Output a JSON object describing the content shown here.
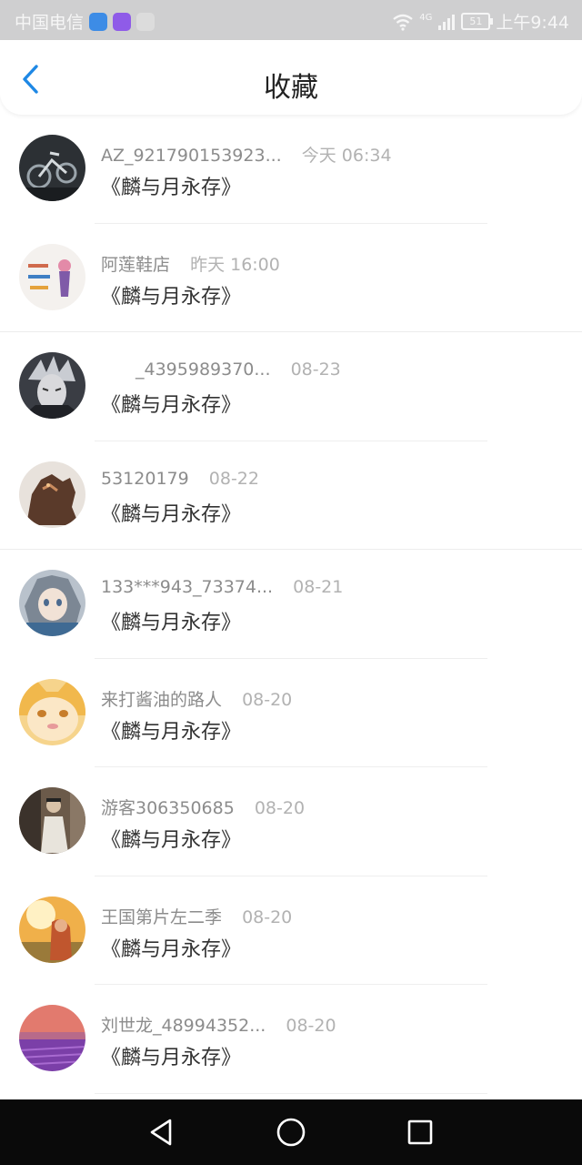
{
  "status_bar": {
    "carrier": "中国电信",
    "network": "4G",
    "battery": "51",
    "time": "上午9:44",
    "app_icons": [
      {
        "name": "shield-app-icon",
        "color": "#3d8ce6"
      },
      {
        "name": "messenger-app-icon",
        "color": "#8f5be8"
      },
      {
        "name": "image-app-icon",
        "color": "#dcdcdc"
      }
    ]
  },
  "header": {
    "title": "收藏",
    "back_icon": "chevron-left-icon",
    "accent": "#1e88e5"
  },
  "favorites": [
    {
      "user": "AZ_921790153923...",
      "date": "今天 06:34",
      "title": "《麟与月永存》",
      "avatar": "bike-avatar"
    },
    {
      "user": "阿莲鞋店",
      "date": "昨天 16:00",
      "title": "《麟与月永存》",
      "avatar": "shoe-store-avatar"
    },
    {
      "user": "_4395989370...",
      "date": "08-23",
      "title": "《麟与月永存》",
      "avatar": "anime-character-avatar"
    },
    {
      "user": "53120179",
      "date": "08-22",
      "title": "《麟与月永存》",
      "avatar": "monster-avatar"
    },
    {
      "user": "133***943_73374...",
      "date": "08-21",
      "title": "《麟与月永存》",
      "avatar": "anime-girl-avatar"
    },
    {
      "user": "来打酱油的路人",
      "date": "08-20",
      "title": "《麟与月永存》",
      "avatar": "cartoon-face-avatar"
    },
    {
      "user": "游客306350685",
      "date": "08-20",
      "title": "《麟与月永存》",
      "avatar": "person-photo-avatar"
    },
    {
      "user": "王国第片左二季",
      "date": "08-20",
      "title": "《麟与月永存》",
      "avatar": "sunset-girl-avatar"
    },
    {
      "user": "刘世龙_48994352...",
      "date": "08-20",
      "title": "《麟与月永存》",
      "avatar": "lavender-field-avatar"
    }
  ],
  "system_nav": {
    "back": "back-triangle-icon",
    "home": "home-circle-icon",
    "recents": "recents-square-icon"
  }
}
